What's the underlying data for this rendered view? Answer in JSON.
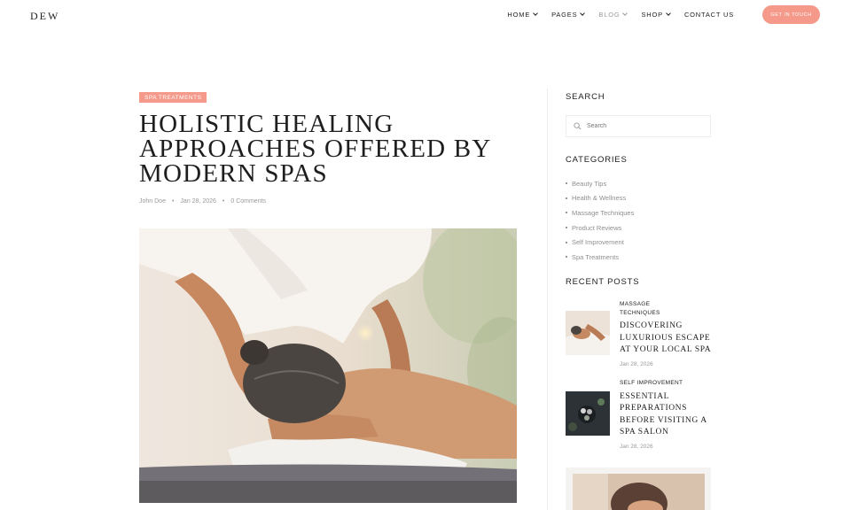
{
  "brand": {
    "logo": "DEW"
  },
  "nav": {
    "items": [
      {
        "label": "HOME",
        "has_dropdown": true
      },
      {
        "label": "PAGES",
        "has_dropdown": true
      },
      {
        "label": "BLOG",
        "has_dropdown": true
      },
      {
        "label": "SHOP",
        "has_dropdown": true
      },
      {
        "label": "CONTACT US",
        "has_dropdown": false
      }
    ],
    "cta_label": "GET IN TOUCH"
  },
  "article": {
    "category": "SPA TREATMENTS",
    "title_lines": [
      "HOLISTIC HEALING",
      "APPROACHES OFFERED BY",
      "MODERN SPAS"
    ],
    "author": "John Doe",
    "date": "Jan 28, 2026",
    "comments": "0 Comments",
    "separator": "•"
  },
  "sidebar": {
    "search": {
      "heading": "SEARCH",
      "placeholder": "Search"
    },
    "categories": {
      "heading": "CATEGORIES",
      "items": [
        "Beauty Tips",
        "Health & Wellness",
        "Massage Techniques",
        "Product Reviews",
        "Self Improvement",
        "Spa Treatments"
      ]
    },
    "recent_posts": {
      "heading": "RECENT POSTS",
      "items": [
        {
          "category_lines": [
            "MASSAGE",
            "TECHNIQUES"
          ],
          "title_lines": [
            "DISCOVERING",
            "LUXURIOUS ESCAPE",
            "AT YOUR LOCAL SPA"
          ],
          "date": "Jan 28, 2026"
        },
        {
          "category_lines": [
            "SELF IMPROVEMENT"
          ],
          "title_lines": [
            "ESSENTIAL",
            "PREPARATIONS",
            "BEFORE VISITING A",
            "SPA SALON"
          ],
          "date": "Jan 28, 2026"
        }
      ]
    }
  },
  "colors": {
    "accent": "#f5998a",
    "text": "#1e1e1e",
    "muted": "#9a9a9a"
  },
  "icons": {
    "search": "search-icon",
    "chevron": "chevron-down-icon"
  }
}
